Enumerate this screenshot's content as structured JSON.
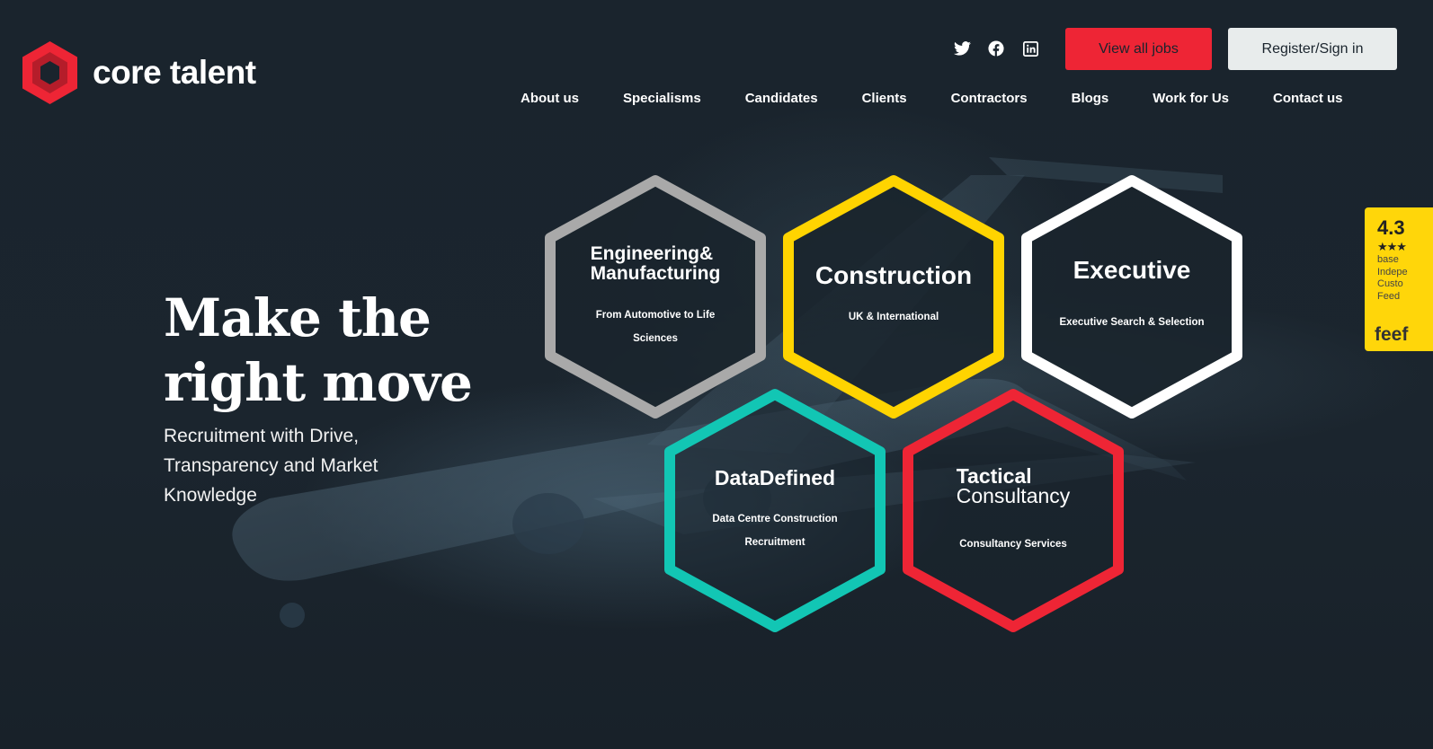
{
  "brand": {
    "name": "core talent",
    "logo_color": "#ee2535"
  },
  "header": {
    "social": [
      {
        "icon": "twitter-icon",
        "glyph": "twitter"
      },
      {
        "icon": "facebook-icon",
        "glyph": "facebook"
      },
      {
        "icon": "linkedin-icon",
        "glyph": "linkedin"
      }
    ],
    "view_jobs_label": "View all jobs",
    "register_label": "Register/Sign in",
    "nav": [
      "About us",
      "Specialisms",
      "Candidates",
      "Clients",
      "Contractors",
      "Blogs",
      "Work for Us",
      "Contact us"
    ]
  },
  "hero": {
    "title_line1": "Make the",
    "title_line2": "right move",
    "subtitle": "Recruitment with Drive, Transparency and Market Knowledge"
  },
  "specialisms": [
    {
      "title_line1": "Engineering&",
      "title_line2": "Manufacturing",
      "subtitle": "From Automotive to Life Sciences",
      "color": "#a9a9a9"
    },
    {
      "title_line1": "Construction",
      "title_line2": "",
      "subtitle": "UK & International",
      "color": "#ffd400"
    },
    {
      "title_line1": "Executive",
      "title_line2": "",
      "subtitle": "Executive Search & Selection",
      "color": "#ffffff"
    },
    {
      "title_line1": "DataDefined",
      "title_line2": "",
      "subtitle": "Data Centre Construction Recruitment",
      "color": "#12c6b4"
    },
    {
      "title_line1": "Tactical",
      "title_line2": "Consultancy",
      "subtitle": "Consultancy Services",
      "color": "#ee2535"
    }
  ],
  "feefo": {
    "score": "4.3",
    "stars": "★★★",
    "text_lines": [
      "base",
      "Indepe",
      "Custo",
      "Feed"
    ],
    "brand": "feef"
  }
}
